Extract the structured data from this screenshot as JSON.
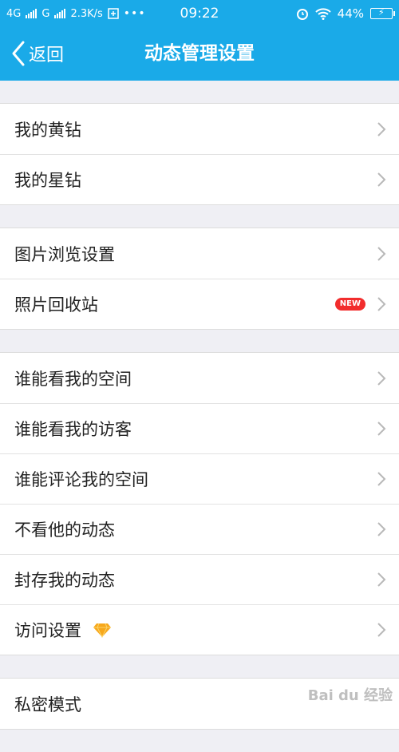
{
  "statusbar": {
    "net1": "4G",
    "net2": "G",
    "speed": "2.3K/s",
    "time": "09:22",
    "battery": "44%"
  },
  "navbar": {
    "back_label": "返回",
    "title": "动态管理设置"
  },
  "groups": [
    [
      {
        "label": "我的黄钻"
      },
      {
        "label": "我的星钻"
      }
    ],
    [
      {
        "label": "图片浏览设置"
      },
      {
        "label": "照片回收站",
        "badge": "NEW"
      }
    ],
    [
      {
        "label": "谁能看我的空间"
      },
      {
        "label": "谁能看我的访客"
      },
      {
        "label": "谁能评论我的空间"
      },
      {
        "label": "不看他的动态"
      },
      {
        "label": "封存我的动态"
      },
      {
        "label": "访问设置",
        "icon": "diamond-icon"
      }
    ],
    [
      {
        "label": "私密模式"
      }
    ]
  ],
  "watermark": "Bai du 经验",
  "colors": {
    "accent": "#1aaae8",
    "badge": "#f22d2d",
    "background": "#efeff4"
  }
}
